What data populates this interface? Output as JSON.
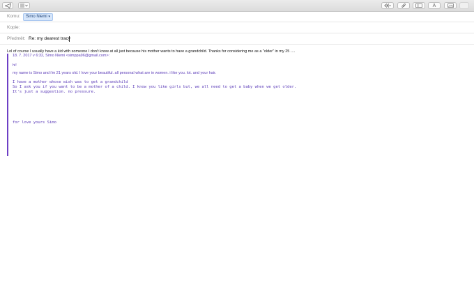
{
  "toolbar": {
    "send_icon": "send-icon",
    "format_icon": "format-list-icon",
    "reply_icon": "reply-arrow-icon",
    "attach_icon": "paperclip-icon",
    "header_fields_icon": "header-fields-icon",
    "font_label": "A",
    "photo_icon": "photo-browser-icon",
    "extra_icon": "blank-icon"
  },
  "headers": {
    "to_label": "Komu:",
    "to_recipient": "Simo Niemi",
    "cc_label": "Kopie:",
    "subject_label": "Předmět:",
    "subject_value": "Re: my dearest tracy"
  },
  "message": {
    "reply_line": "Lol of course I usually have a kid with someone I don't know at all just because his mother wants to have a grandchild. Thanks for considering me as a \"older\" in my 25 ....",
    "quote_header": "18. 7. 2017 v 6:32, Simo Niemi <simppa96@gmail.com>:",
    "greeting": "hi!",
    "intro": "my name is Simo and i'm 21 years old. I love your beautiful. all personal what are in women. i like you. lot. and your hair.",
    "mono_lines": [
      "I have a mother whose wish was to get a grandchild",
      "So I ask you if you want to be a mother of a child. I know you like girls but, we all need to get a baby when we get older.",
      "It's just a suggestion. no pressure."
    ],
    "signoff": "for love yours Simo"
  },
  "colors": {
    "quote_bar": "#6d3fc5",
    "quote_text": "#5b3bb8",
    "token_bg": "#d6e6fb"
  }
}
